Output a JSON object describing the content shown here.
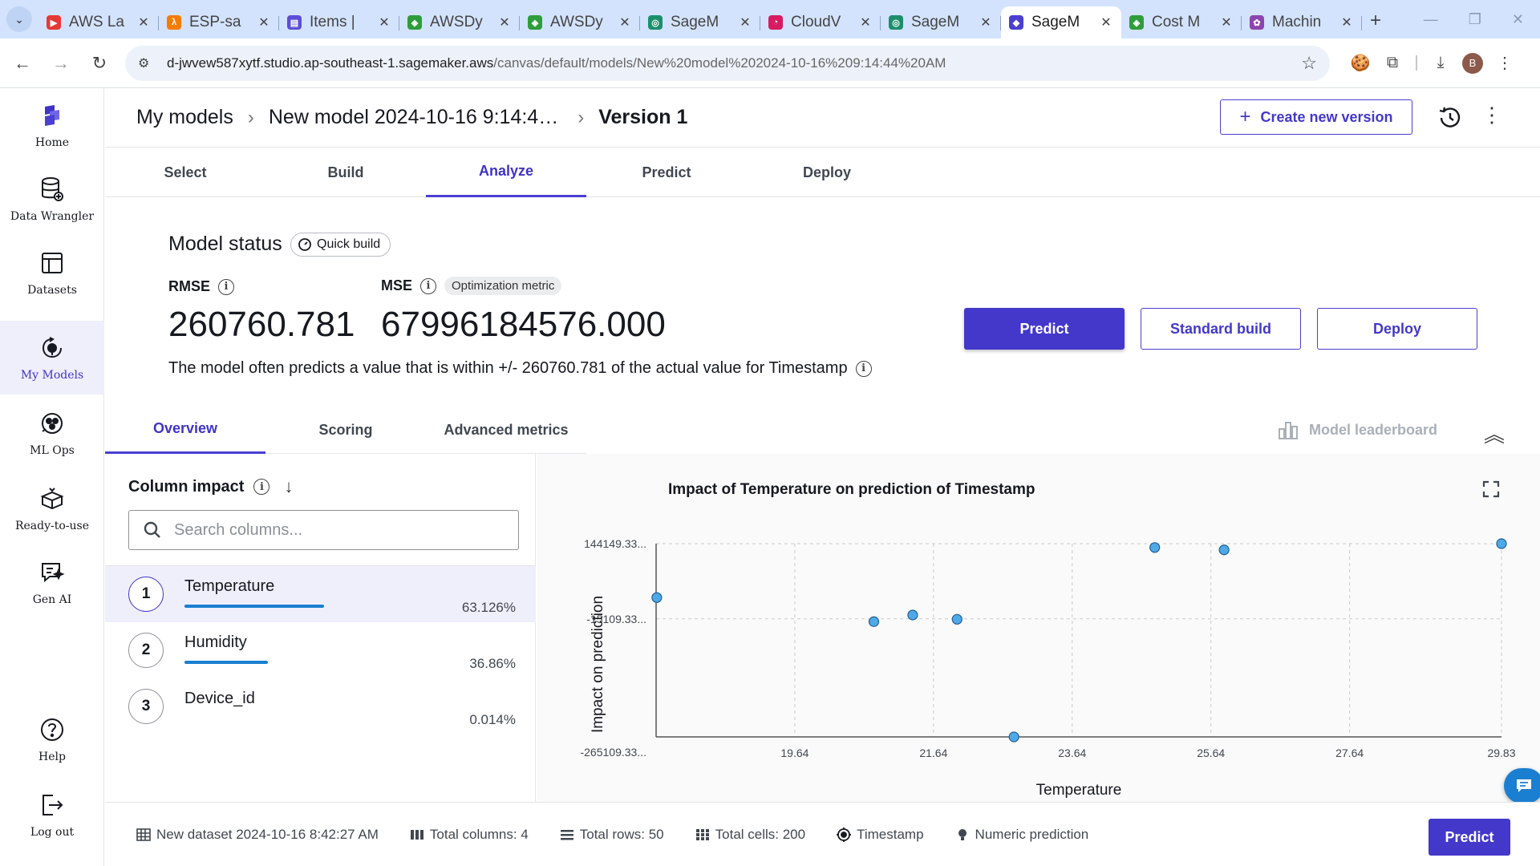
{
  "browser": {
    "tabs": [
      {
        "title": "AWS La",
        "color": "#e53935",
        "glyph": "▶"
      },
      {
        "title": "ESP-sa",
        "color": "#f57c00",
        "glyph": "λ"
      },
      {
        "title": "Items |",
        "color": "#5c4fd6",
        "glyph": "▤"
      },
      {
        "title": "AWSDy",
        "color": "#2e9d3a",
        "glyph": "◈"
      },
      {
        "title": "AWSDy",
        "color": "#2e9d3a",
        "glyph": "◈"
      },
      {
        "title": "SageM",
        "color": "#1b8f6a",
        "glyph": "◎"
      },
      {
        "title": "CloudV",
        "color": "#d81b60",
        "glyph": "◔"
      },
      {
        "title": "SageM",
        "color": "#1b8f6a",
        "glyph": "◎"
      },
      {
        "title": "SageM",
        "color": "#4a3fd0",
        "glyph": "◆",
        "active": true
      },
      {
        "title": "Cost M",
        "color": "#2e9d3a",
        "glyph": "◈"
      },
      {
        "title": "Machin",
        "color": "#8e44ad",
        "glyph": "✿"
      }
    ],
    "url_host": "d-jwvew587xytf.studio.ap-southeast-1.sagemaker.aws",
    "url_path": "/canvas/default/models/New%20model%202024-10-16%209:14:44%20AM",
    "profile_initial": "B"
  },
  "sidebar": {
    "items": [
      {
        "label": "Home",
        "icon": "home-icon"
      },
      {
        "label": "Data Wrangler",
        "icon": "data-wrangler-icon"
      },
      {
        "label": "Datasets",
        "icon": "datasets-icon"
      },
      {
        "label": "My Models",
        "icon": "my-models-icon",
        "active": true
      },
      {
        "label": "ML Ops",
        "icon": "ml-ops-icon"
      },
      {
        "label": "Ready-to-use",
        "icon": "ready-to-use-icon"
      },
      {
        "label": "Gen AI",
        "icon": "gen-ai-icon"
      },
      {
        "label": "Help",
        "icon": "help-icon"
      },
      {
        "label": "Log out",
        "icon": "logout-icon"
      }
    ]
  },
  "header": {
    "breadcrumb": [
      "My models",
      "New model 2024-10-16 9:14:4…",
      "Version 1"
    ],
    "create_version_label": "Create new version"
  },
  "steps": {
    "tabs": [
      "Select",
      "Build",
      "Analyze",
      "Predict",
      "Deploy"
    ],
    "active": "Analyze"
  },
  "model_status": {
    "title": "Model status",
    "build_type": "Quick build",
    "metrics": [
      {
        "label": "RMSE",
        "value": "260760.781"
      },
      {
        "label": "MSE",
        "value": "67996184576.000",
        "badge": "Optimization metric"
      }
    ],
    "description": "The model often predicts a value that is within +/- 260760.781 of the actual value for Timestamp",
    "actions": {
      "predict": "Predict",
      "standard_build": "Standard build",
      "deploy": "Deploy"
    }
  },
  "analysis_tabs": {
    "tabs": [
      "Overview",
      "Scoring",
      "Advanced metrics"
    ],
    "active": "Overview",
    "leaderboard_label": "Model leaderboard"
  },
  "column_impact": {
    "title": "Column impact",
    "search_placeholder": "Search columns...",
    "columns": [
      {
        "rank": "1",
        "name": "Temperature",
        "impact": "63.126%",
        "fraction": 0.819
      },
      {
        "rank": "2",
        "name": "Humidity",
        "impact": "36.86%",
        "fraction": 0.488
      },
      {
        "rank": "3",
        "name": "Device_id",
        "impact": "0.014%",
        "fraction": 0
      }
    ]
  },
  "chart_data": {
    "type": "scatter",
    "title": "Impact of Temperature on prediction of Timestamp",
    "xlabel": "Temperature",
    "ylabel": "Impact on prediction",
    "x_ticks": [
      "19.64",
      "21.64",
      "23.64",
      "25.64",
      "27.64",
      "29.83"
    ],
    "y_ticks": [
      "144149.33...",
      "-15109.33...",
      "-265109.33..."
    ],
    "xlim": [
      17.64,
      29.83
    ],
    "ylim": [
      -265109.33,
      144149.33
    ],
    "grid": true,
    "points": [
      {
        "x": 17.65,
        "y": 30000
      },
      {
        "x": 20.78,
        "y": -21000
      },
      {
        "x": 21.34,
        "y": -7000
      },
      {
        "x": 21.98,
        "y": -16000
      },
      {
        "x": 22.8,
        "y": -265109.33
      },
      {
        "x": 24.83,
        "y": 136000
      },
      {
        "x": 25.83,
        "y": 131000
      },
      {
        "x": 29.83,
        "y": 144149.33
      }
    ],
    "point_color": "#4fa9e6"
  },
  "footer": {
    "dataset": "New dataset 2024-10-16 8:42:27 AM",
    "total_columns": "Total columns: 4",
    "total_rows": "Total rows: 50",
    "total_cells": "Total cells: 200",
    "target": "Timestamp",
    "model_type": "Numeric prediction",
    "predict_label": "Predict"
  }
}
